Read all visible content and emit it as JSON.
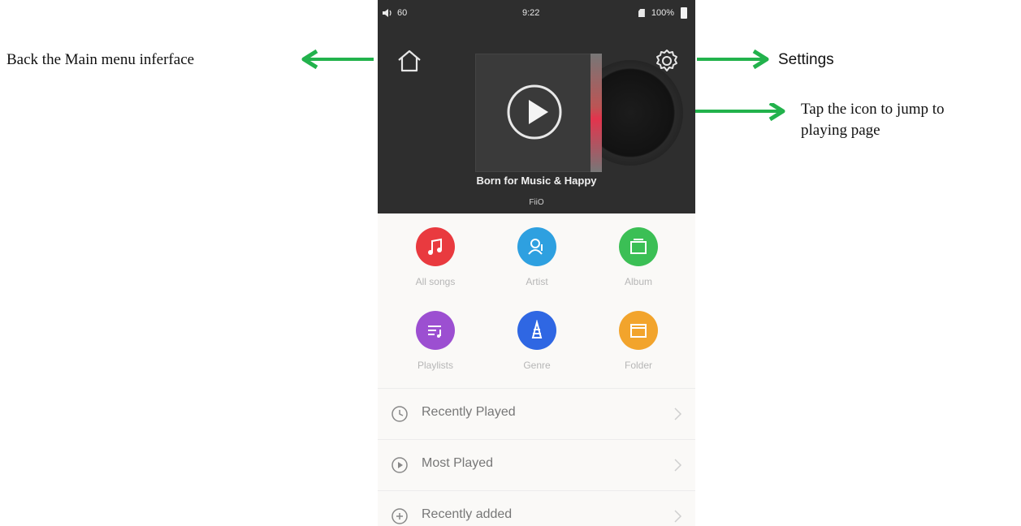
{
  "annotations": {
    "home": "Back the Main menu inferface",
    "settings": "Settings",
    "play_line1": "Tap the icon to jump to",
    "play_line2": "playing page"
  },
  "status_bar": {
    "volume": "60",
    "time": "9:22",
    "battery": "100%"
  },
  "now_playing": {
    "title": "Born for Music & Happy",
    "artist": "FiiO"
  },
  "categories": [
    {
      "label": "All songs",
      "color": "#e93a3f",
      "icon": "music-note-icon"
    },
    {
      "label": "Artist",
      "color": "#2ea0e0",
      "icon": "person-icon"
    },
    {
      "label": "Album",
      "color": "#3bbf55",
      "icon": "album-icon"
    },
    {
      "label": "Playlists",
      "color": "#9c4fd1",
      "icon": "playlist-icon"
    },
    {
      "label": "Genre",
      "color": "#2f67e3",
      "icon": "genre-icon"
    },
    {
      "label": "Folder",
      "color": "#f2a42c",
      "icon": "folder-icon"
    }
  ],
  "list": [
    {
      "label": "Recently Played",
      "icon": "clock-icon"
    },
    {
      "label": "Most Played",
      "icon": "play-circle-icon"
    },
    {
      "label": "Recently added",
      "icon": "plus-circle-icon"
    }
  ],
  "colors": {
    "arrow": "#22b24c",
    "header_bg": "#2e2e2e"
  }
}
